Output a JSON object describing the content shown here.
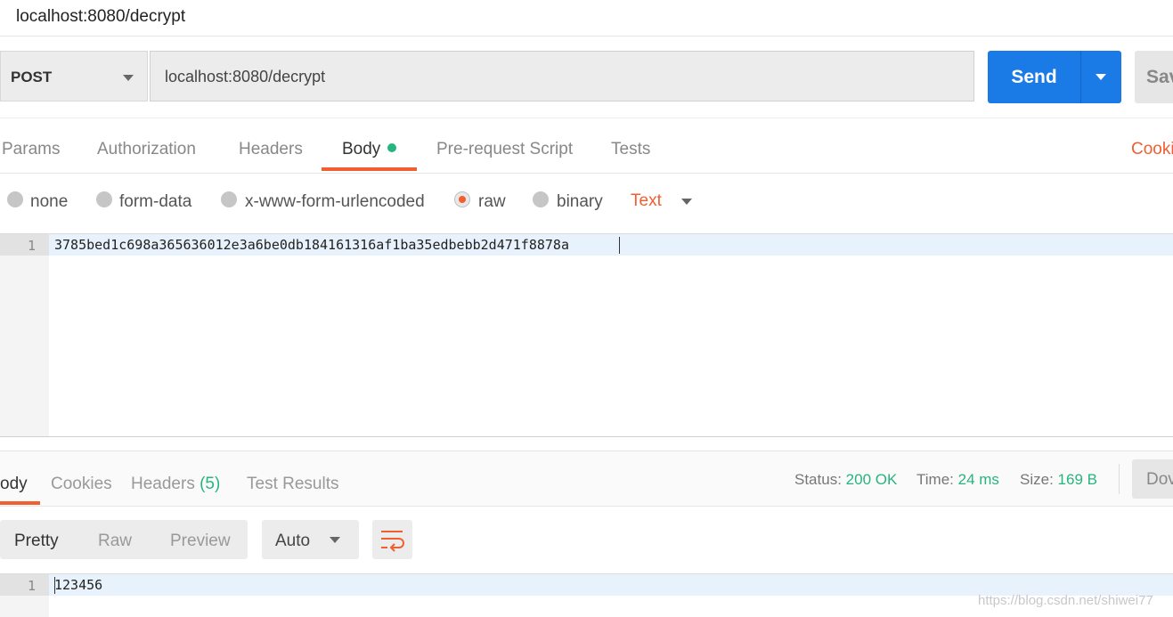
{
  "title": "localhost:8080/decrypt",
  "request": {
    "method": "POST",
    "url": "localhost:8080/decrypt",
    "send_label": "Send",
    "save_label": "Sav"
  },
  "request_tabs": [
    "Params",
    "Authorization",
    "Headers",
    "Body",
    "Pre-request Script",
    "Tests"
  ],
  "cookies_link": "Cooki",
  "body_types": [
    "none",
    "form-data",
    "x-www-form-urlencoded",
    "raw",
    "binary"
  ],
  "body_type_selected": "raw",
  "raw_format": "Text",
  "editor": {
    "line_number": "1",
    "content": "3785bed1c698a365636012e3a6be0db184161316af1ba35edbebb2d471f8878a"
  },
  "response": {
    "tabs": {
      "body": "ody",
      "cookies": "Cookies",
      "headers": "Headers",
      "headers_count": "(5)",
      "test_results": "Test Results"
    },
    "status_label": "Status:",
    "status_value": "200 OK",
    "time_label": "Time:",
    "time_value": "24 ms",
    "size_label": "Size:",
    "size_value": "169 B",
    "download_label": "Dov",
    "view_modes": [
      "Pretty",
      "Raw",
      "Preview"
    ],
    "view_mode_selected": "Pretty",
    "format": "Auto",
    "line_number": "1",
    "content": "123456"
  },
  "watermark": "https://blog.csdn.net/shiwei77",
  "colors": {
    "accent": "#f05e31",
    "send": "#1b7be6",
    "success": "#26b47f"
  }
}
